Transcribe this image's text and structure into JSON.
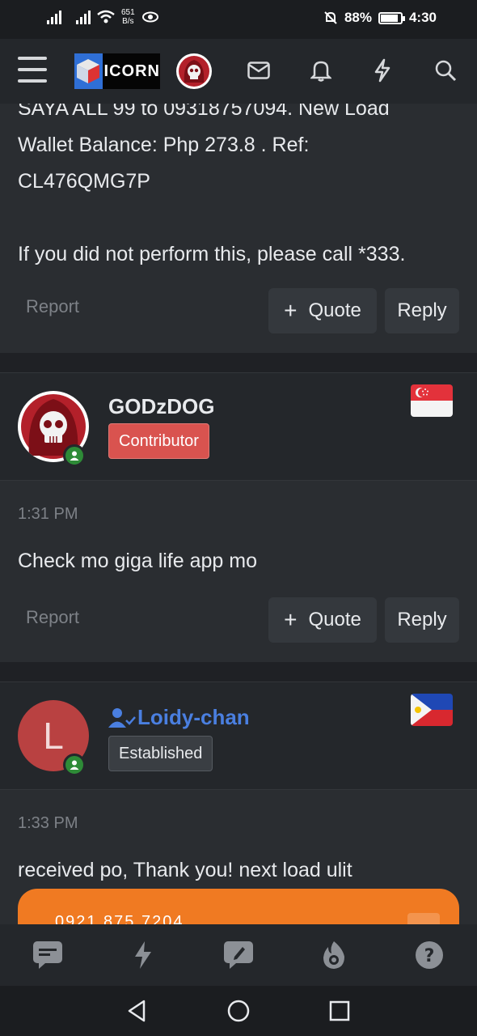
{
  "status_bar": {
    "net_speed_value": "651",
    "net_speed_unit": "B/s",
    "battery": "88%",
    "battery_level": 0.88,
    "time": "4:30"
  },
  "header": {
    "logo_text": "ICORN",
    "icons": [
      "menu-icon",
      "envelope-icon",
      "bell-icon",
      "bolt-icon",
      "search-icon"
    ]
  },
  "prev_post": {
    "line1": "SAYA ALL 99 to 09318757094. New Load",
    "line2": "Wallet Balance: Php 273.8 . Ref:",
    "line3": "CL476QMG7P",
    "line4": "If you did not perform this, please call *333.",
    "report_label": "Report",
    "quote_label": "Quote",
    "reply_label": "Reply"
  },
  "post1": {
    "username": "GODzDOG",
    "badge": "Contributor",
    "badge_color": "#d9534f",
    "flag": "Singapore",
    "time": "1:31 PM",
    "message": "Check mo giga life app mo",
    "report_label": "Report",
    "quote_label": "Quote",
    "reply_label": "Reply"
  },
  "post2": {
    "username": "Loidy-chan",
    "username_color": "#4a7fe0",
    "avatar_letter": "L",
    "avatar_color": "#b94141",
    "badge": "Established",
    "flag": "Philippines",
    "time": "1:33 PM",
    "message": "received po, Thank you! next load ulit",
    "card_partial_text": "0921 875 7204",
    "card_color": "#f07a22"
  },
  "bottom_nav": {
    "icons": [
      "chat-icon",
      "bolt-icon",
      "compose-icon",
      "fire-icon",
      "help-icon"
    ]
  },
  "system_nav": {
    "icons": [
      "back-icon",
      "home-icon",
      "recents-icon"
    ]
  }
}
